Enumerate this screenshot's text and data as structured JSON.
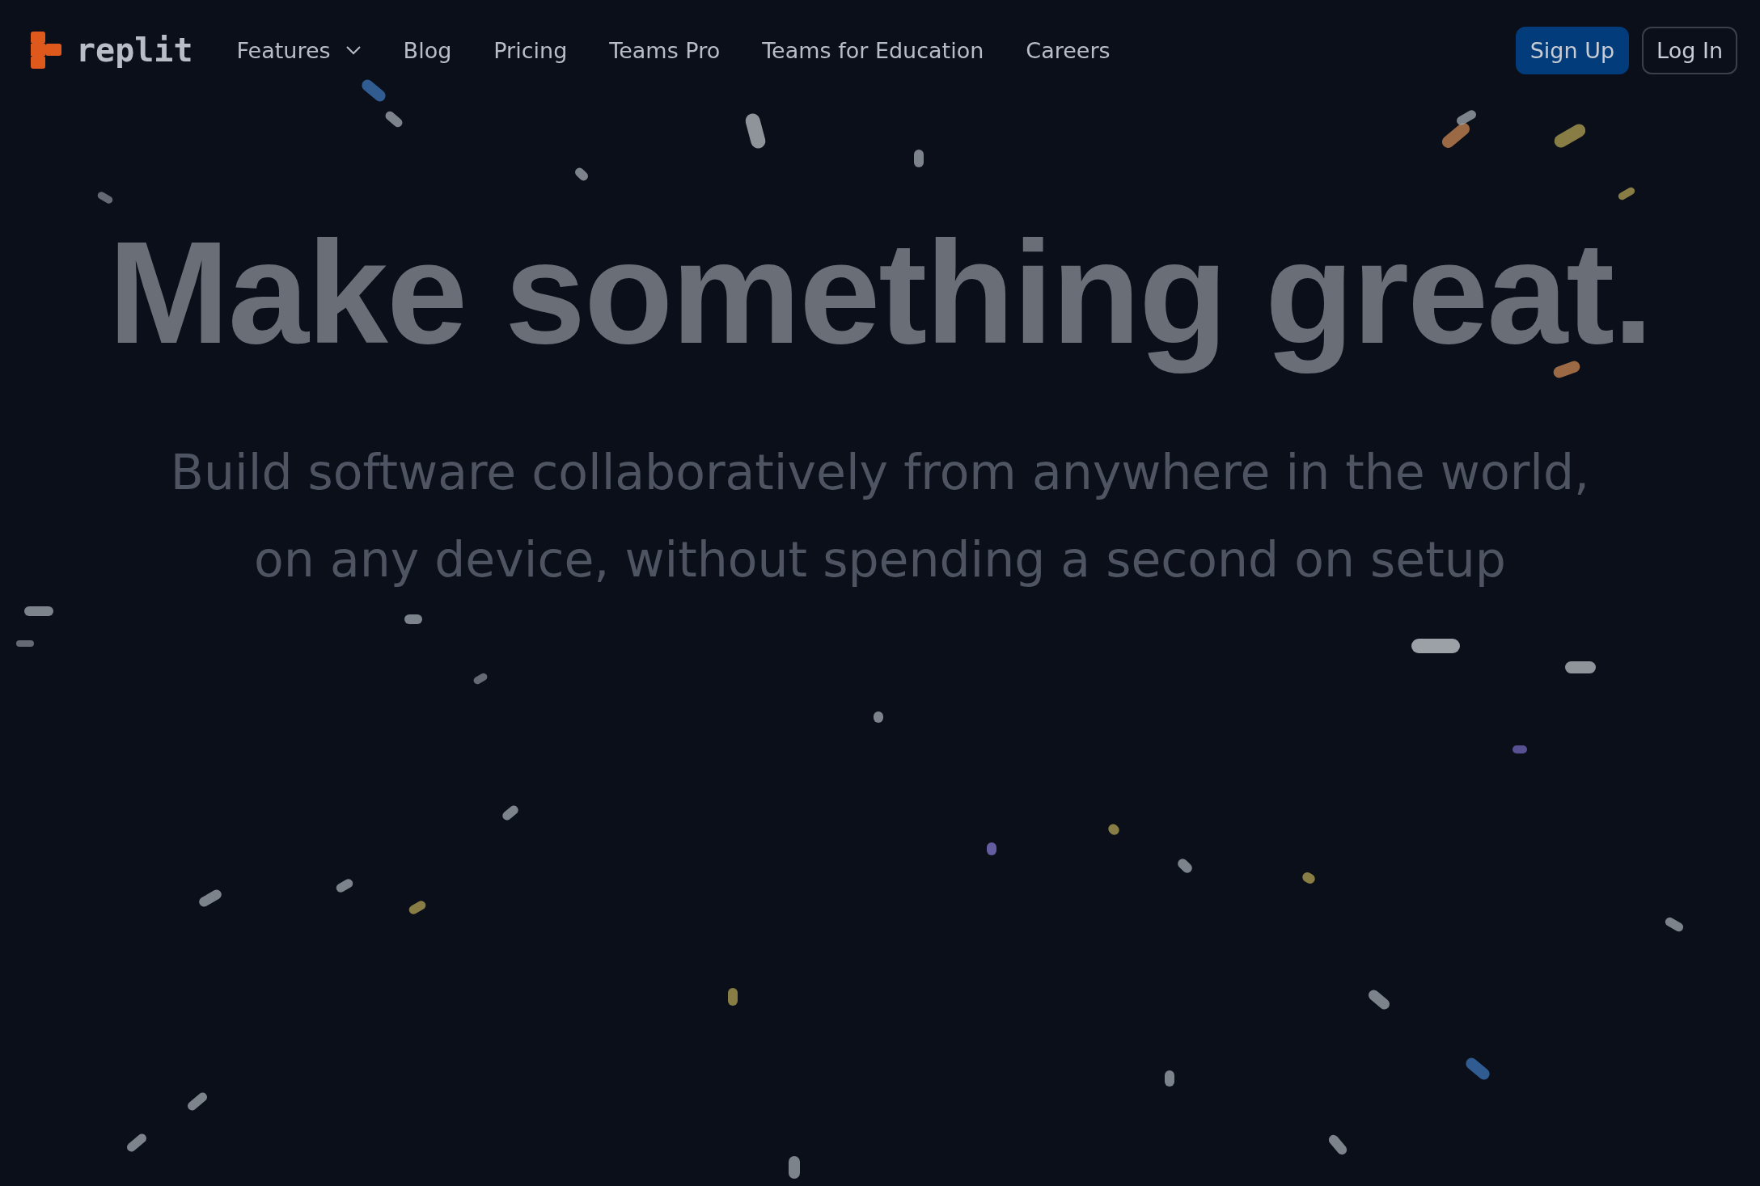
{
  "nav": {
    "logo": "replit",
    "links": [
      {
        "label": "Features",
        "dropdown": true
      },
      {
        "label": "Blog",
        "dropdown": false
      },
      {
        "label": "Pricing",
        "dropdown": false
      },
      {
        "label": "Teams Pro",
        "dropdown": false
      },
      {
        "label": "Teams for Education",
        "dropdown": false
      },
      {
        "label": "Careers",
        "dropdown": false
      }
    ],
    "buttons": [
      {
        "label": "Sign Up",
        "kind": "primary"
      },
      {
        "label": "Log In",
        "kind": "outline"
      }
    ]
  },
  "hero": {
    "title": "Make something great.",
    "subtitle_lines": [
      "Build software collaboratively from anywhere in the world,",
      "on any device, without spending a second on setup"
    ]
  }
}
